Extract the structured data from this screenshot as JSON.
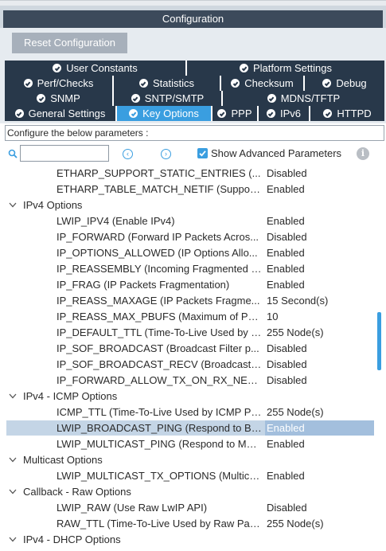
{
  "window": {
    "title": "Configuration"
  },
  "toolbar": {
    "reset_label": "Reset Configuration"
  },
  "tabs": {
    "row1": [
      {
        "label": "User Constants",
        "active": false
      },
      {
        "label": "Platform Settings",
        "active": false
      }
    ],
    "row2": [
      {
        "label": "Perf/Checks",
        "active": false
      },
      {
        "label": "Statistics",
        "active": false
      },
      {
        "label": "Checksum",
        "active": false
      },
      {
        "label": "Debug",
        "active": false
      }
    ],
    "row3": [
      {
        "label": "SNMP",
        "active": false
      },
      {
        "label": "SNTP/SMTP",
        "active": false
      },
      {
        "label": "MDNS/TFTP",
        "active": false
      }
    ],
    "row4": [
      {
        "label": "General Settings",
        "active": false
      },
      {
        "label": "Key Options",
        "active": true
      },
      {
        "label": "PPP",
        "active": false
      },
      {
        "label": "IPv6",
        "active": false
      },
      {
        "label": "HTTPD",
        "active": false
      }
    ]
  },
  "params_label": "Configure the below parameters :",
  "search": {
    "value": "",
    "placeholder": "",
    "icon": "search-icon"
  },
  "advanced": {
    "label": "Show Advanced Parameters",
    "checked": true
  },
  "colors": {
    "tab_bg": "#28384a",
    "tab_active": "#3a9ee0",
    "title_bg": "#3c4a5b",
    "selected_row": "#c4d5e6",
    "selected_value": "#a3bfdd"
  },
  "tree": [
    {
      "type": "param",
      "name": "ETHARP_SUPPORT_STATIC_ENTRIES (...",
      "value": "Disabled"
    },
    {
      "type": "param",
      "name": "ETHARP_TABLE_MATCH_NETIF (Support...",
      "value": "Enabled"
    },
    {
      "type": "group",
      "name": "IPv4 Options"
    },
    {
      "type": "param",
      "name": "LWIP_IPV4 (Enable IPv4)",
      "value": "Enabled"
    },
    {
      "type": "param",
      "name": "IP_FORWARD (Forward IP Packets Acros...",
      "value": "Disabled"
    },
    {
      "type": "param",
      "name": "IP_OPTIONS_ALLOWED (IP Options Allo...",
      "value": "Enabled"
    },
    {
      "type": "param",
      "name": "IP_REASSEMBLY (Incoming Fragmented I...",
      "value": "Enabled"
    },
    {
      "type": "param",
      "name": "IP_FRAG (IP Packets Fragmentation)",
      "value": "Enabled"
    },
    {
      "type": "param",
      "name": "IP_REASS_MAXAGE (IP Packets Fragme...",
      "value": "15 Second(s)"
    },
    {
      "type": "param",
      "name": "IP_REASS_MAX_PBUFS (Maximum of Pb...",
      "value": "10"
    },
    {
      "type": "param",
      "name": "IP_DEFAULT_TTL (Time-To-Live Used by T...",
      "value": "255 Node(s)"
    },
    {
      "type": "param",
      "name": "IP_SOF_BROADCAST (Broadcast Filter p...",
      "value": "Disabled"
    },
    {
      "type": "param",
      "name": "IP_SOF_BROADCAST_RECV (Broadcast ...",
      "value": "Disabled"
    },
    {
      "type": "param",
      "name": "IP_FORWARD_ALLOW_TX_ON_RX_NETI...",
      "value": "Disabled"
    },
    {
      "type": "group",
      "name": "IPv4 - ICMP Options"
    },
    {
      "type": "param",
      "name": "ICMP_TTL (Time-To-Live Used by ICMP Pa...",
      "value": "255 Node(s)"
    },
    {
      "type": "param",
      "name": "LWIP_BROADCAST_PING (Respond to Br...",
      "value": "Enabled",
      "selected": true
    },
    {
      "type": "param",
      "name": "LWIP_MULTICAST_PING (Respond to Mul...",
      "value": "Enabled"
    },
    {
      "type": "group",
      "name": "Multicast Options"
    },
    {
      "type": "param",
      "name": "LWIP_MULTICAST_TX_OPTIONS (Multica...",
      "value": "Enabled"
    },
    {
      "type": "group",
      "name": "Callback - Raw Options"
    },
    {
      "type": "param",
      "name": "LWIP_RAW (Use Raw LwIP API)",
      "value": "Disabled"
    },
    {
      "type": "param",
      "name": "RAW_TTL (Time-To-Live Used by Raw Pac...",
      "value": "255 Node(s)"
    },
    {
      "type": "group",
      "name": "IPv4 - DHCP Options"
    }
  ]
}
